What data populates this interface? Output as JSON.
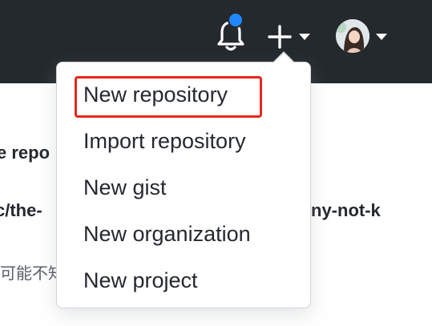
{
  "header": {
    "bell_icon": "bell-icon",
    "plus_icon": "plus-icon",
    "caret_icon": "triangle-down-icon",
    "notification_color": "#2188ff",
    "header_bg": "#24292e"
  },
  "background": {
    "title_fragment": "e repo",
    "url_fragment_left": "c/the-",
    "url_fragment_right": "ny-not-k",
    "desc_fragment": "可能不知"
  },
  "dropdown": {
    "items": [
      {
        "label": "New repository"
      },
      {
        "label": "Import repository"
      },
      {
        "label": "New gist"
      },
      {
        "label": "New organization"
      },
      {
        "label": "New project"
      }
    ],
    "highlight_color": "#e8261b"
  }
}
